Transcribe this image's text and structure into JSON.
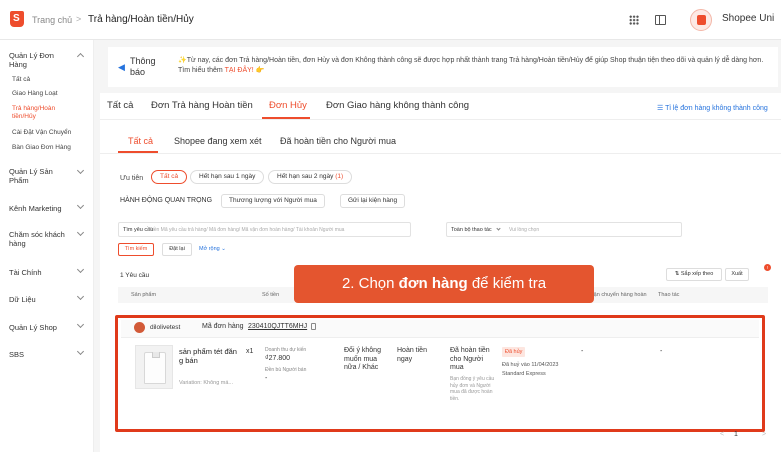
{
  "header": {
    "home": "Trang chủ",
    "separator": ">",
    "page": "Trả hàng/Hoàn tiền/Hủy",
    "shop_name": "Shopee Uni"
  },
  "sidebar": {
    "groups": [
      {
        "label": "Quản Lý Đơn Hàng",
        "items": [
          "Tất cả",
          "Giao Hàng Loạt",
          "Trả hàng/Hoàn tiền/Hủy",
          "Cài Đặt Vận Chuyển",
          "Bàn Giao Đơn Hàng"
        ],
        "active": "Trả hàng/Hoàn tiền/Hủy"
      },
      {
        "label": "Quản Lý Sản Phẩm"
      },
      {
        "label": "Kênh Marketing"
      },
      {
        "label": "Chăm sóc khách hàng"
      },
      {
        "label": "Tài Chính"
      },
      {
        "label": "Dữ Liệu"
      },
      {
        "label": "Quản Lý Shop"
      },
      {
        "label": "SBS"
      }
    ]
  },
  "notice": {
    "title": "Thông báo",
    "text": "✨Từ nay, các đơn Trả hàng/Hoàn tiền, đơn Hủy và đơn Không thành công sẽ được hợp nhất thành trang Trả hàng/Hoàn tiền/Hủy để giúp Shop thuận tiện theo dõi và quản lý dễ dàng hơn. Tìm hiểu thêm ",
    "link": "TẠI ĐÂY! 👉"
  },
  "tabs": [
    "Tất cả",
    "Đơn Trả hàng Hoàn tiền",
    "Đơn Hủy",
    "Đơn Giao hàng không thành công"
  ],
  "active_tab": "Đơn Hủy",
  "stat_link": "☰ Tỉ lệ đơn hàng không thành công",
  "subtabs": [
    "Tất cả",
    "Shopee đang xem xét",
    "Đã hoàn tiền cho Người mua"
  ],
  "active_subtab": "Tất cả",
  "priority": {
    "label": "Ưu tiên",
    "chips": [
      {
        "label": "Tất cả"
      },
      {
        "label": "Hết hạn sau 1 ngày"
      },
      {
        "label": "Hết hạn sau 2 ngày",
        "count": "(1)"
      }
    ]
  },
  "actions": {
    "label": "HÀNH ĐỘNG QUAN TRỌNG",
    "chips": [
      "Thương lượng với Người mua",
      "Gửi lại kiện hàng"
    ]
  },
  "search": {
    "label": "Tìm yêu cầu",
    "placeholder": "Điền Mã yêu cầu trả hàng/ Mã đơn hàng/ Mã vận đơn hoàn hàng/ Tài khoản Người mua",
    "filter_label": "Toàn bộ thao tác",
    "filter_placeholder": "Vui lòng chọn",
    "search_btn": "Tìm kiếm",
    "reset_btn": "Đặt lại",
    "more": "Mở rộng ⌄"
  },
  "list": {
    "count": "1 Yêu cầu",
    "sort_btn": "⇅ Sắp xếp theo",
    "export_btn": "Xuất",
    "export_badge": "!",
    "columns": [
      "Sản phẩm",
      "Số tiền",
      "Lý do",
      "Phương án",
      "Trạng thái hoàn tiền",
      "Trạng thái",
      "Vận chuyển hàng hoàn",
      "Thao tác"
    ]
  },
  "callout": {
    "prefix": "2. Chọn ",
    "bold": "đơn hàng",
    "suffix": " để kiểm tra"
  },
  "order": {
    "buyer": "dilolivetest",
    "code_label": "Mã đơn hàng",
    "code": "230410QJTT6MHJ",
    "product_name": "sản phẩm tét đăn g bán",
    "qty": "x1",
    "variation": "Variation: Không má...",
    "revenue_label": "Doanh thu dự kiến",
    "revenue": "₫27.800",
    "comp_label": "Đền bù Người bán",
    "comp": "-",
    "reason": "Đổi ý không muốn mua nữa / Khác",
    "solution": "Hoàn tiền ngay",
    "refund_title": "Đã hoàn tiền cho Người mua",
    "refund_note": "Bạn đồng ý yêu cầu hủy đơn và Người mua đã được hoàn tiền.",
    "status_badge": "Đã hủy",
    "cancel_date": "Đã huỷ vào 11/04/2023",
    "ship_method": "Standard Express",
    "return_ship": "-",
    "action": "-"
  },
  "pager": {
    "prev": "<",
    "page": "1",
    "next": ">"
  }
}
